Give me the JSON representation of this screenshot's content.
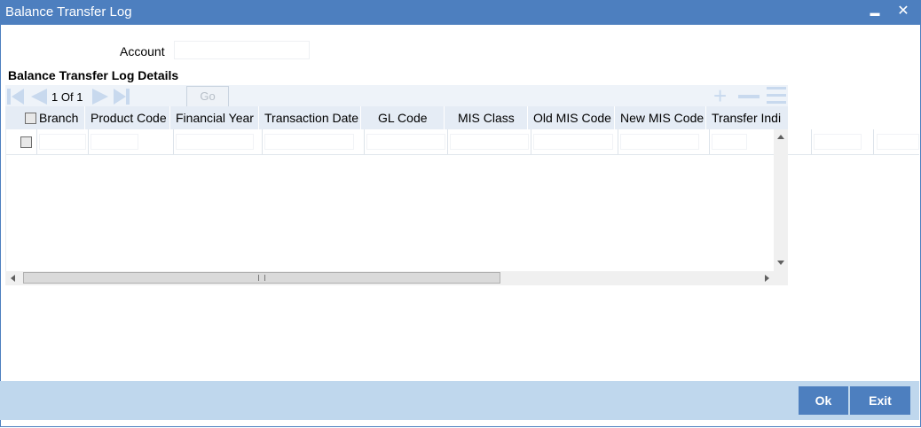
{
  "window": {
    "title": "Balance Transfer Log",
    "minimize_glyph": "▬",
    "close_glyph": "✕"
  },
  "form": {
    "account_label": "Account",
    "account_value": ""
  },
  "details": {
    "section_title": "Balance Transfer Log Details",
    "pager": {
      "current_page": "1",
      "of_label": "Of",
      "total_pages": "1",
      "go_label": "Go",
      "page_input_value": ""
    },
    "columns": [
      "Branch",
      "Product Code",
      "Financial Year",
      "Transaction Date",
      "GL Code",
      "MIS Class",
      "Old MIS Code",
      "New MIS Code",
      "Transfer Indi"
    ]
  },
  "footer": {
    "ok_label": "Ok",
    "exit_label": "Exit"
  },
  "colors": {
    "titlebar": "#4d7fbf",
    "footer_bg": "#bfd7ed",
    "header_bg": "#e5ecf5",
    "button_bg": "#4d7fbf",
    "disabled_icon": "#c8d9ee"
  },
  "icons": [
    "first-page-icon",
    "prev-page-icon",
    "next-page-icon",
    "last-page-icon",
    "add-row-icon",
    "delete-row-icon",
    "single-view-icon",
    "minimize-icon",
    "close-icon"
  ]
}
